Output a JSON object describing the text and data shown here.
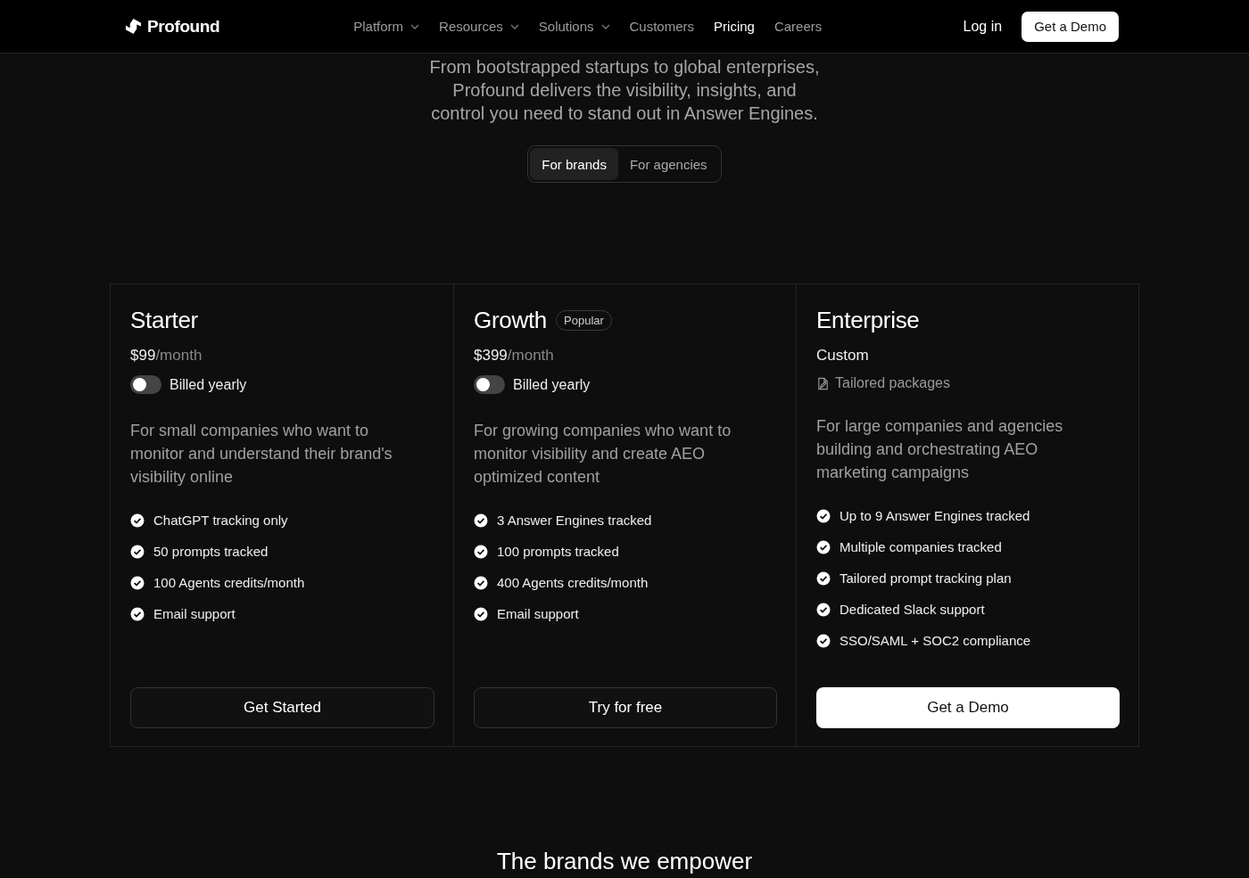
{
  "brand": {
    "name": "Profound"
  },
  "nav": [
    {
      "label": "Platform",
      "dropdown": true,
      "selected": false
    },
    {
      "label": "Resources",
      "dropdown": true,
      "selected": false
    },
    {
      "label": "Solutions",
      "dropdown": true,
      "selected": false
    },
    {
      "label": "Customers",
      "dropdown": false,
      "selected": false
    },
    {
      "label": "Pricing",
      "dropdown": false,
      "selected": true
    },
    {
      "label": "Careers",
      "dropdown": false,
      "selected": false
    }
  ],
  "actions": {
    "login": "Log in",
    "demo": "Get a Demo"
  },
  "intro": "From bootstrapped startups to global enterprises, Profound delivers the visibility, insights, and control you need to stand out in Answer Engines.",
  "audience_tabs": [
    {
      "label": "For brands",
      "selected": true
    },
    {
      "label": "For agencies",
      "selected": false
    }
  ],
  "plans": [
    {
      "name": "Starter",
      "price": "$99",
      "period": "/month",
      "billing": {
        "label": "Billed yearly",
        "on": false
      },
      "description": "For small companies who want to monitor and understand their brand's visibility online",
      "features": [
        "ChatGPT tracking only",
        "50 prompts tracked",
        "100 Agents credits/month",
        "Email support"
      ],
      "cta": {
        "label": "Get Started",
        "kind": "secondary"
      }
    },
    {
      "name": "Growth",
      "badge": "Popular",
      "price": "$399",
      "period": "/month",
      "billing": {
        "label": "Billed yearly",
        "on": false
      },
      "description": "For growing companies who want to monitor visibility and create AEO optimized content",
      "features": [
        "3 Answer Engines tracked",
        "100 prompts tracked",
        "400 Agents credits/month",
        "Email support"
      ],
      "cta": {
        "label": "Try for free",
        "kind": "secondary"
      }
    },
    {
      "name": "Enterprise",
      "custom": "Custom",
      "note": "Tailored packages",
      "description": "For large companies and agencies building and orchestrating AEO marketing campaigns",
      "features": [
        "Up to 9 Answer Engines tracked",
        "Multiple companies tracked",
        "Tailored prompt tracking plan",
        "Dedicated Slack support",
        "SSO/SAML + SOC2 compliance"
      ],
      "cta": {
        "label": "Get a Demo",
        "kind": "primary"
      }
    }
  ],
  "next_section": {
    "title": "The brands we empower"
  }
}
